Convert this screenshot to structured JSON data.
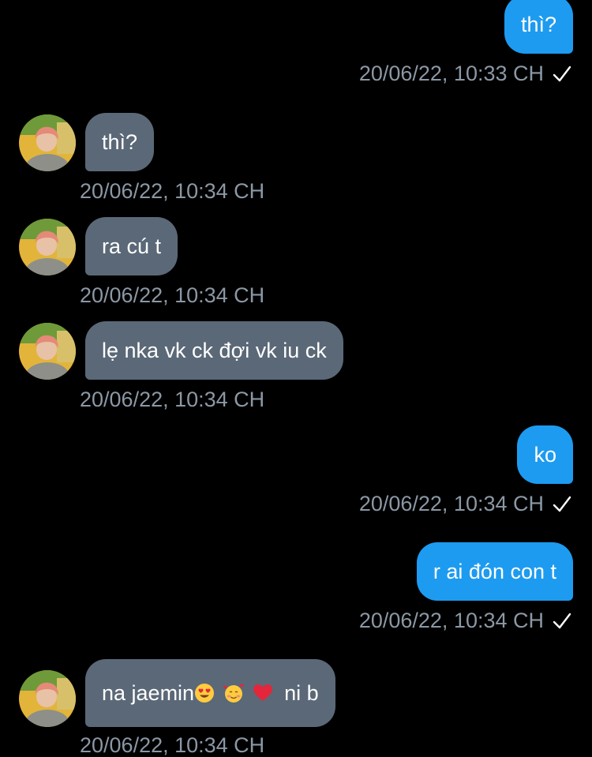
{
  "messages": [
    {
      "direction": "out",
      "text": "thì?",
      "time": "20/06/22, 10:33 CH",
      "seen_icon": "check-icon"
    },
    {
      "direction": "in",
      "text": "thì?",
      "time": "20/06/22, 10:34 CH"
    },
    {
      "direction": "in",
      "text": "ra cú t",
      "time": "20/06/22, 10:34 CH"
    },
    {
      "direction": "in",
      "text": "lẹ nka vk ck đợi vk iu ck",
      "time": "20/06/22, 10:34 CH"
    },
    {
      "direction": "out",
      "text": "ko",
      "time": "20/06/22, 10:34 CH",
      "seen_icon": "check-icon"
    },
    {
      "direction": "out",
      "text": "r ai đón con t",
      "time": "20/06/22, 10:34 CH",
      "seen_icon": "check-icon"
    },
    {
      "direction": "in",
      "text_before": "na jaemin",
      "emojis": [
        "heart-eyes-emoji",
        "smiling-face-with-hearts-emoji",
        "red-heart-emoji"
      ],
      "text_after": "ni b",
      "time": "20/06/22, 10:34 CH"
    }
  ],
  "colors": {
    "background": "#000000",
    "outgoing_bubble": "#1d9bf0",
    "incoming_bubble": "#5b6877",
    "timestamp": "#8b98a5"
  }
}
